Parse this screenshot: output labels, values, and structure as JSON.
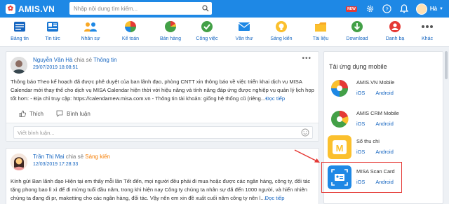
{
  "topbar": {
    "logo_text": "AMIS.VN",
    "search_placeholder": "Nhập nội dung tìm kiếm...",
    "new_badge": "NEW",
    "user_name": "Hà",
    "icons": [
      "search-icon",
      "new-badge-icon",
      "settings-icon",
      "help-icon",
      "notification-bell-icon",
      "avatar",
      "chevron-down-icon"
    ]
  },
  "apps": [
    {
      "label": "Bảng tin",
      "icon": "newsfeed-icon",
      "color": "#1565c0"
    },
    {
      "label": "Tin tức",
      "icon": "news-icon",
      "color": "#1565c0"
    },
    {
      "label": "Nhân sự",
      "icon": "people-icon",
      "color": "#f9a825"
    },
    {
      "label": "Kế toán",
      "icon": "accounting-icon",
      "color": "#e53935"
    },
    {
      "label": "Bán hàng",
      "icon": "sales-icon",
      "color": "#43a047"
    },
    {
      "label": "Công việc",
      "icon": "task-check-icon",
      "color": "#43a047"
    },
    {
      "label": "Văn thư",
      "icon": "mail-icon",
      "color": "#1565c0"
    },
    {
      "label": "Sáng kiến",
      "icon": "idea-icon",
      "color": "#fbc02d"
    },
    {
      "label": "Tài liệu",
      "icon": "folder-icon",
      "color": "#f9a825"
    },
    {
      "label": "Download",
      "icon": "download-icon",
      "color": "#43a047"
    },
    {
      "label": "Danh bạ",
      "icon": "contacts-icon",
      "color": "#e53935"
    },
    {
      "label": "Khác",
      "icon": "more-icon",
      "color": "#555555"
    }
  ],
  "post1": {
    "author": "Nguyễn Văn Hà",
    "share_text": "chia sẻ",
    "topic": "Thông tin",
    "date": "29/07/2019 18:08:51",
    "body": "Thông báo Theo kế hoạch đã được phê duyệt của ban lãnh đạo, phòng CNTT xin thông báo về việc triển khai dịch vụ MISA Calendar mới thay thế cho dịch vụ MISA Calendar hiện thời với hiệu năng và tính năng đáp ứng được nghiệp vụ quản lý lịch họp tốt hơn: - Địa chỉ truy cập: https://calendarnew.misa.com.vn - Thông tin tài khoản: giống hệ thống cũ (riêng...",
    "read_more": "Đọc tiếp",
    "like": "Thích",
    "comment": "Bình luận",
    "comment_placeholder": "Viết bình luận..."
  },
  "post2": {
    "author": "Trần Thị Mai",
    "share_text": "chia sẻ",
    "topic": "Sáng kiến",
    "date": "12/03/2019 17:28:33",
    "body": "Kính gửi Ban lãnh đạo Hiện tại em thấy mỗi lần Tết đến, mọi người đều phải đi mua hoặc được các ngân hàng, công ty, đối tác tặng phong bao lì xì để đi mừng tuổi đầu năm, trong khi hiện nay Công ty chúng ta nhân sự đã đến 1000 người, và hiển nhiên chúng ta đang đi pr, maketting cho các ngân hàng, đối tác. Vậy nên em xin đề xuất cuối năm công ty nên l...",
    "read_more": "Đọc tiếp"
  },
  "sidebar": {
    "title": "Tải ứng dụng mobile",
    "apps": [
      {
        "name": "AMIS.VN Mobile",
        "ios": "iOS",
        "android": "Android"
      },
      {
        "name": "AMIS CRM Mobile",
        "ios": "iOS",
        "android": "Android"
      },
      {
        "name": "Sổ thu chi",
        "ios": "iOS",
        "android": "Android"
      },
      {
        "name": "MISA Scan Card",
        "ios": "iOS",
        "android": "Android"
      }
    ]
  }
}
